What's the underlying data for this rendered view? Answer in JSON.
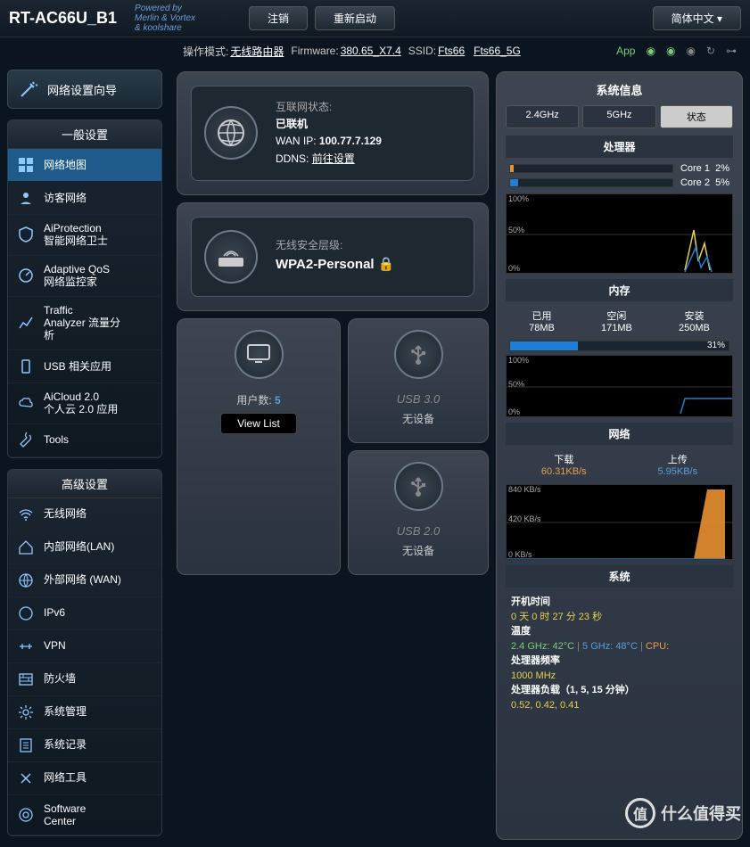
{
  "header": {
    "model": "RT-AC66U_B1",
    "powered1": "Powered by",
    "powered2": "Merlin & Vortex",
    "powered3": "& koolshare",
    "logout": "注销",
    "reboot": "重新启动",
    "lang": "简体中文"
  },
  "info": {
    "mode_label": "操作模式:",
    "mode": "无线路由器",
    "fw_label": "Firmware:",
    "fw": "380.65_X7.4",
    "ssid_label": "SSID:",
    "ssid1": "Fts66",
    "ssid2": "Fts66_5G",
    "app": "App"
  },
  "sidebar": {
    "wizard": "网络设置向导",
    "general_h": "一般设置",
    "general": [
      "网络地图",
      "访客网络",
      "AiProtection\n智能网络卫士",
      "Adaptive QoS\n网络监控家",
      "Traffic\nAnalyzer 流量分\n析",
      "USB 相关应用",
      "AiCloud 2.0\n个人云 2.0 应用",
      "Tools"
    ],
    "advanced_h": "高级设置",
    "advanced": [
      "无线网络",
      "内部网络(LAN)",
      "外部网络 (WAN)",
      "IPv6",
      "VPN",
      "防火墙",
      "系统管理",
      "系统记录",
      "网络工具",
      "Software\nCenter"
    ]
  },
  "cards": {
    "internet_title": "互联网状态:",
    "internet_status": "已联机",
    "wan_label": "WAN IP:",
    "wan_ip": "100.77.7.129",
    "ddns_label": "DDNS:",
    "ddns_link": "前往设置",
    "security_title": "无线安全层级:",
    "security_val": "WPA2-Personal",
    "clients_label": "用户数:",
    "clients_count": "5",
    "view_list": "View List",
    "usb3": "USB 3.0",
    "usb2": "USB 2.0",
    "no_device": "无设备"
  },
  "sys": {
    "title": "系统信息",
    "tabs": [
      "2.4GHz",
      "5GHz",
      "状态"
    ],
    "cpu_h": "处理器",
    "core1": "Core 1",
    "core1_pct": "2%",
    "core2": "Core 2",
    "core2_pct": "5%",
    "mem_h": "内存",
    "mem_used_l": "已用",
    "mem_used": "78MB",
    "mem_free_l": "空闲",
    "mem_free": "171MB",
    "mem_total_l": "安装",
    "mem_total": "250MB",
    "mem_pct": "31%",
    "net_h": "网络",
    "down_l": "下载",
    "down": "60.31KB/s",
    "up_l": "上传",
    "up": "5.95KB/s",
    "net_y1": "840 KB/s",
    "net_y2": "420 KB/s",
    "net_y3": "0 KB/s",
    "g100": "100%",
    "g50": "50%",
    "g0": "0%",
    "system_h": "系统",
    "uptime_l": "开机时间",
    "uptime": "0 天 0 时 27 分 23 秒",
    "temp_l": "温度",
    "temp_24": "2.4 GHz: 42°C",
    "temp_5": "5 GHz: 48°C",
    "temp_cpu": "CPU:",
    "freq_l": "处理器频率",
    "freq": "1000 MHz",
    "load_l": "处理器负载（1, 5, 15 分钟）",
    "load": "0.52, 0.42, 0.41"
  },
  "watermark": "什么值得买",
  "wm_char": "值"
}
